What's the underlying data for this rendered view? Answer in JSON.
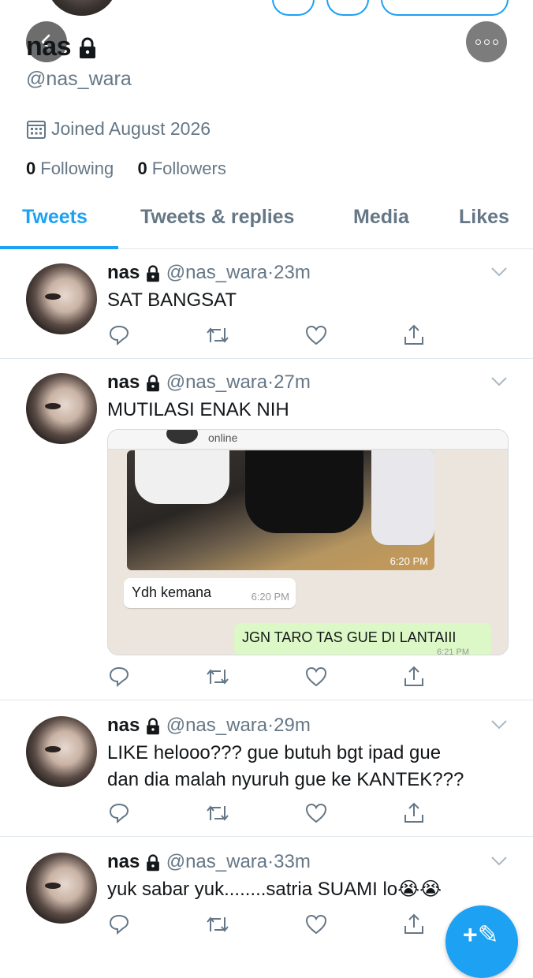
{
  "profile": {
    "name": "nas",
    "handle": "@nas_wara",
    "joined": "Joined August 2026",
    "following_count": "0",
    "following_label": "Following",
    "followers_count": "0",
    "followers_label": "Followers"
  },
  "tabs": [
    {
      "label": "Tweets",
      "active": true
    },
    {
      "label": "Tweets & replies"
    },
    {
      "label": "Media"
    },
    {
      "label": "Likes"
    }
  ],
  "tweets": [
    {
      "name": "nas",
      "handle": "@nas_wara",
      "time": "23m",
      "text": "SAT BANGSAT"
    },
    {
      "name": "nas",
      "handle": "@nas_wara",
      "time": "27m",
      "text": "MUTILASI ENAK NIH",
      "media": {
        "status": "online",
        "photo_time": "6:20 PM",
        "incoming_text": "Ydh kemana",
        "incoming_time": "6:20 PM",
        "outgoing_text": "JGN TARO TAS GUE DI LANTAIII",
        "outgoing_time": "6:21 PM"
      }
    },
    {
      "name": "nas",
      "handle": "@nas_wara",
      "time": "29m",
      "text_lines": [
        "LIKE helooo??? gue butuh bgt ipad gue",
        "dan dia malah nyuruh gue ke KANTEK???"
      ]
    },
    {
      "name": "nas",
      "handle": "@nas_wara",
      "time": "33m",
      "text": "yuk sabar yuk........satria SUAMI lo😭😭"
    }
  ],
  "icons": {
    "back": "back-arrow-icon",
    "more": "more-options-icon",
    "lock": "lock-icon",
    "calendar": "calendar-icon",
    "reply": "reply-icon",
    "retweet": "retweet-icon",
    "like": "heart-icon",
    "share": "share-icon",
    "compose": "compose-tweet-icon"
  },
  "colors": {
    "accent": "#1da1f2",
    "muted": "#657786",
    "divider": "#e1e8ed"
  }
}
